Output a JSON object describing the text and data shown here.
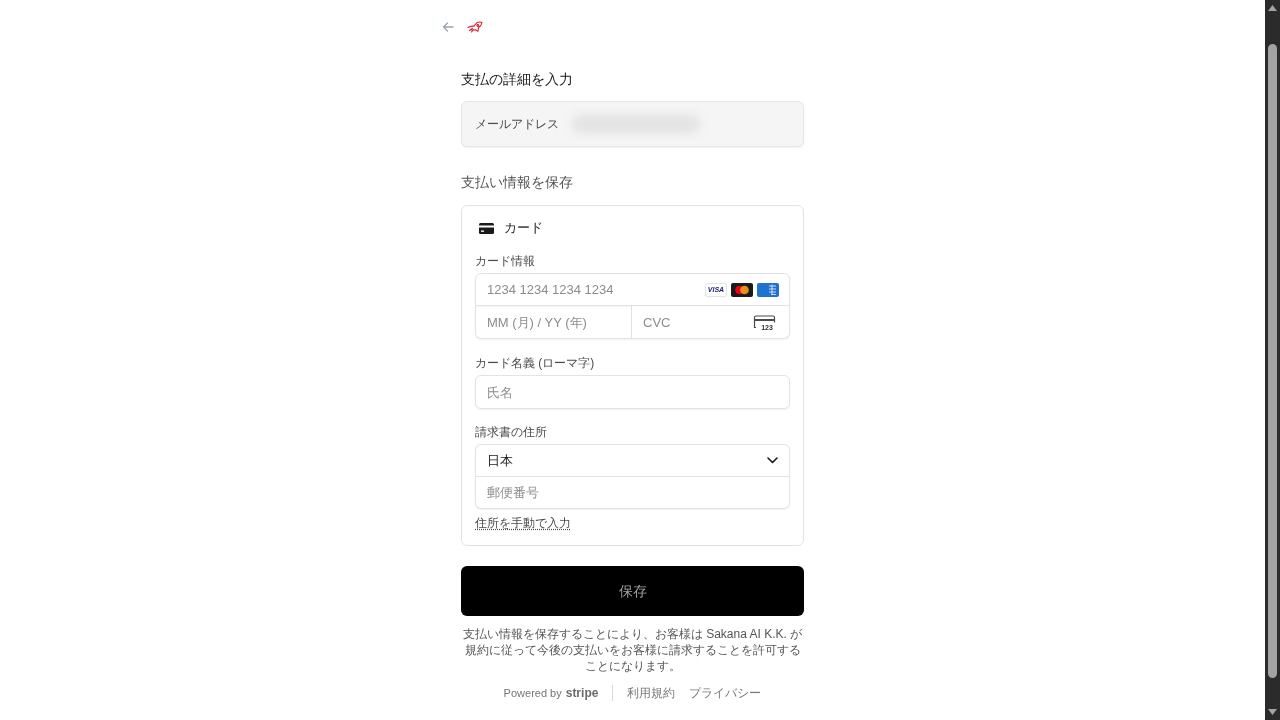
{
  "title": "支払の詳細を入力",
  "email": {
    "label": "メールアドレス"
  },
  "save_heading": "支払い情報を保存",
  "payment_method": {
    "label": "カード"
  },
  "card_info": {
    "label": "カード情報",
    "number": {
      "placeholder": "1234 1234 1234 1234"
    },
    "brands": [
      {
        "kind": "visa",
        "text": "VISA"
      },
      {
        "kind": "mastercard"
      },
      {
        "kind": "amex"
      }
    ],
    "expiry": {
      "placeholder": "MM (月) / YY (年)"
    },
    "cvc": {
      "placeholder": "CVC",
      "icon_text": "123"
    }
  },
  "cardholder": {
    "label": "カード名義 (ローマ字)",
    "placeholder": "氏名"
  },
  "billing_address": {
    "label": "請求書の住所",
    "country": {
      "value": "日本"
    },
    "postal_code": {
      "placeholder": "郵便番号"
    },
    "manual_entry_link": "住所を手動で入力"
  },
  "submit_button": {
    "label": "保存",
    "disabled": true
  },
  "terms": "支払い情報を保存することにより、お客様は Sakana AI K.K. が規約に従って今後の支払いをお客様に請求することを許可することになります。",
  "footer": {
    "powered_by": "Powered by",
    "brand": "stripe",
    "links": [
      "利用規約",
      "プライバシー"
    ]
  }
}
